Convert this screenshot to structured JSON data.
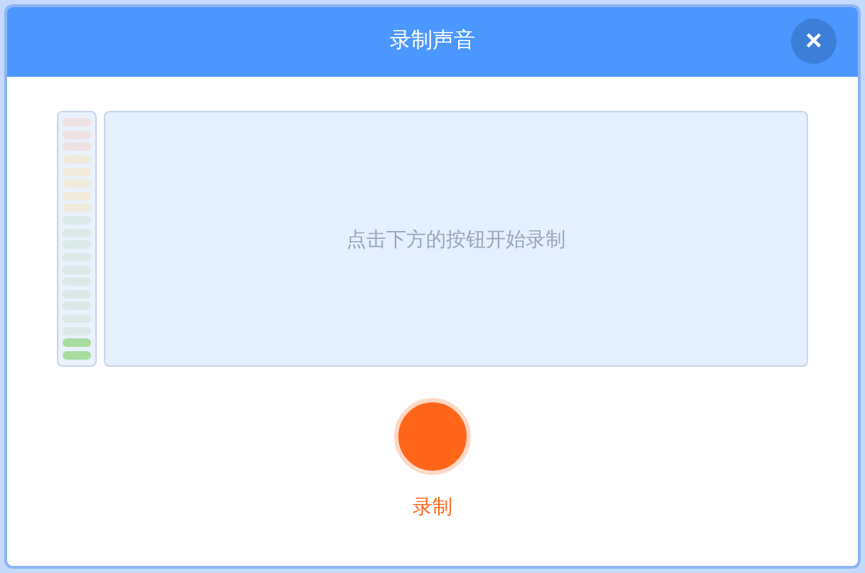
{
  "dialog": {
    "title": "录制声音",
    "close_label": "×"
  },
  "meter": {
    "level": 0.1
  },
  "waveform": {
    "hint": "点击下方的按钮开始录制"
  },
  "record_button": {
    "label": "录制",
    "recording": false
  }
}
